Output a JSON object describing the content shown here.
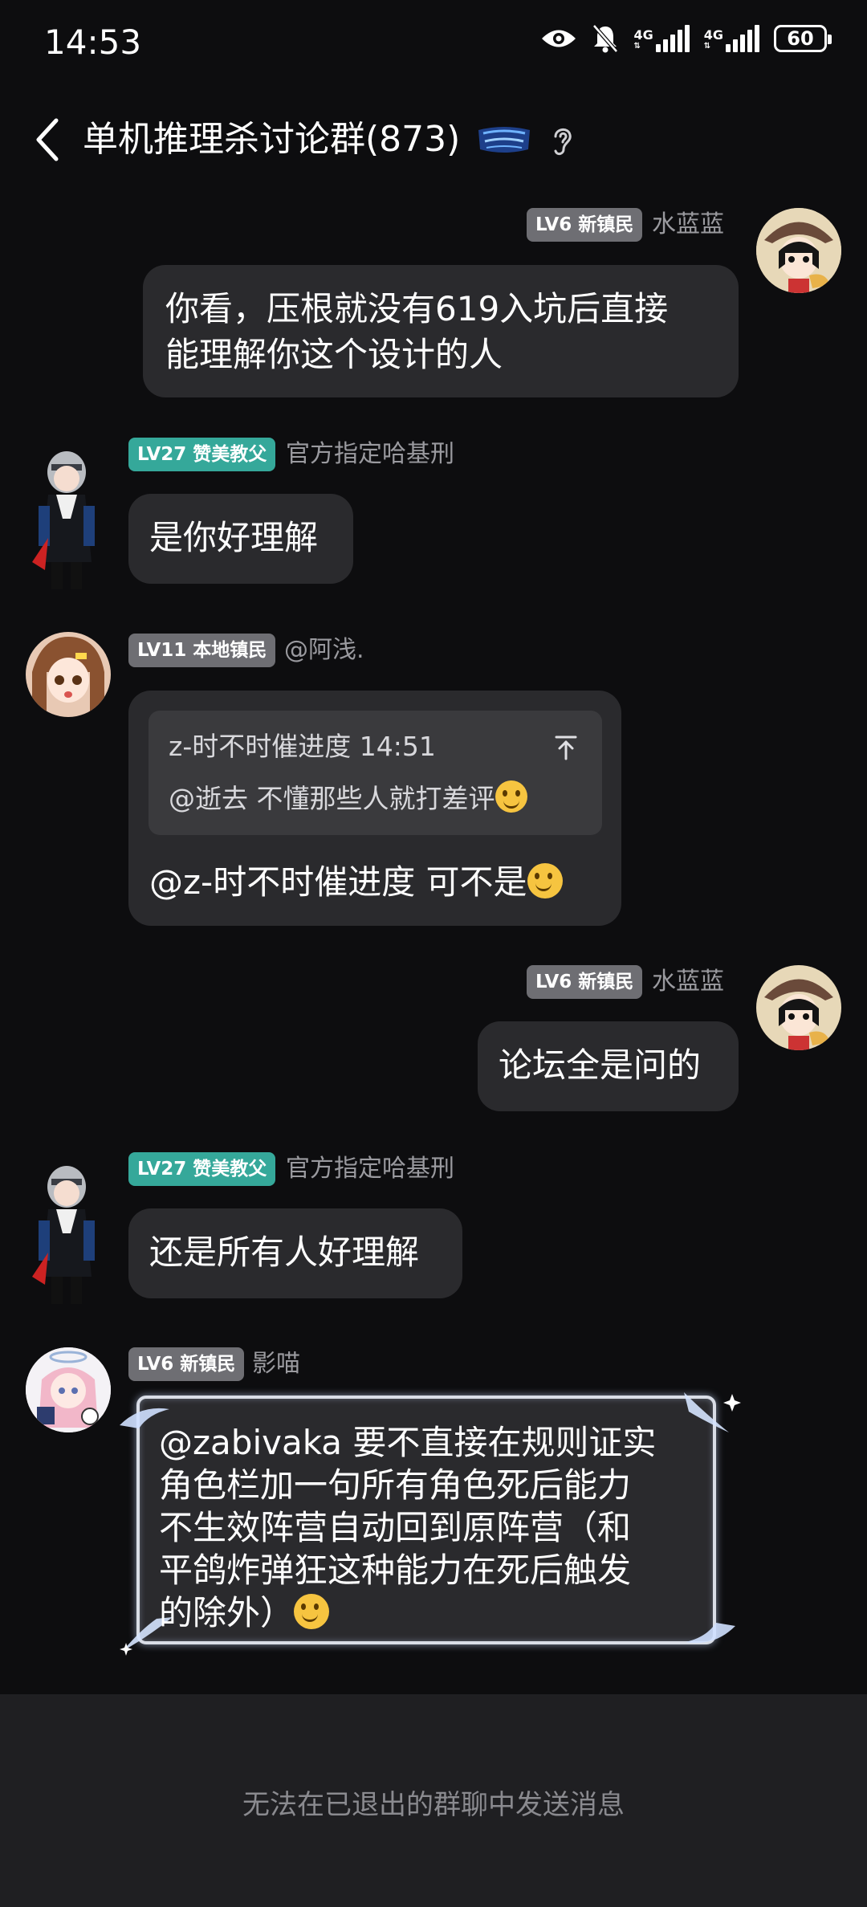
{
  "status_bar": {
    "time": "14:53",
    "network1": "4G",
    "network2": "4G",
    "battery": "60",
    "icons": [
      "eye-icon",
      "bell-off-icon",
      "signal-icon",
      "signal-icon",
      "battery-icon"
    ]
  },
  "header": {
    "title": "单机推理杀讨论群(873)",
    "back_icon": "chevron-left-icon",
    "ear_icon": "ear-icon"
  },
  "messages": [
    {
      "side": "right",
      "badge": "LV6 新镇民",
      "badge_color": "#6e6e73",
      "sender": "水蓝蓝",
      "lines": [
        "你看，压根就没有619入坑后直接",
        "能理解你这个设计的人"
      ]
    },
    {
      "side": "left",
      "badge": "LV27 赞美教父",
      "badge_color": "#35a89a",
      "sender": "官方指定哈基刑",
      "lines": [
        "是你好理解"
      ]
    },
    {
      "side": "left",
      "badge": "LV11 本地镇民",
      "badge_color": "#6e6e73",
      "sender": "@阿浅.",
      "quote": {
        "author_time": "z-时不时催进度 14:51",
        "text": "@逝去 不懂那些人就打差评",
        "jump_icon": "scroll-to-quote-icon"
      },
      "lines": [
        "@z-时不时催进度 可不是"
      ]
    },
    {
      "side": "right",
      "badge": "LV6 新镇民",
      "badge_color": "#6e6e73",
      "sender": "水蓝蓝",
      "lines": [
        "论坛全是问的"
      ]
    },
    {
      "side": "left",
      "badge": "LV27 赞美教父",
      "badge_color": "#35a89a",
      "sender": "官方指定哈基刑",
      "lines": [
        "还是所有人好理解"
      ]
    },
    {
      "side": "left",
      "badge": "LV6 新镇民",
      "badge_color": "#6e6e73",
      "sender": "影喵",
      "lines": [
        "@zabivaka 要不直接在规则证实",
        "角色栏加一句所有角色死后能力",
        "不生效阵营自动回到原阵营（和",
        "平鸽炸弹狂这种能力在死后触发",
        "的除外）"
      ]
    }
  ],
  "footer": {
    "notice": "无法在已退出的群聊中发送消息"
  },
  "colors": {
    "background": "#0d0d0f",
    "bubble": "#2a2a2d",
    "badge_teal": "#35a89a",
    "badge_gray": "#6e6e73"
  }
}
